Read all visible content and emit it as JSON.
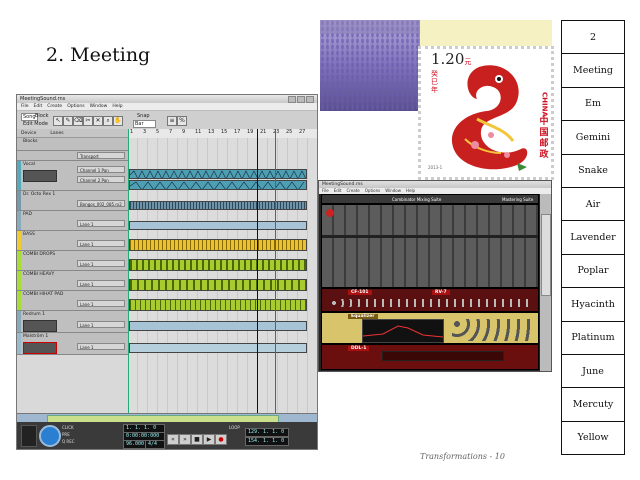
{
  "slide": {
    "title": "2. Meeting",
    "footer": "Transformations - 10"
  },
  "side_table": [
    "2",
    "Meeting",
    "Em",
    "Gemini",
    "Snake",
    "Air",
    "Lavender",
    "Poplar",
    "Hyacinth",
    "Platinum",
    "June",
    "Mercuty",
    "Yellow"
  ],
  "sequencer": {
    "window_title": "MeetingSound.rns",
    "menu": [
      "File",
      "Edit",
      "Create",
      "Options",
      "Window",
      "Help"
    ],
    "mode_tabs": [
      "Song",
      "Block"
    ],
    "edit_mode": "Edit Mode",
    "snap_label": "Snap",
    "snap_value": "Bar",
    "col_device": "Device",
    "col_lanes": "Lanes",
    "ruler_marks": [
      "1",
      "3",
      "5",
      "7",
      "9",
      "11",
      "13",
      "15",
      "17",
      "19",
      "21",
      "23",
      "25",
      "27"
    ],
    "tracks": [
      {
        "name": "Blocks",
        "lane": "",
        "color": "#cfcfcf",
        "clip": "none"
      },
      {
        "name": "Transport",
        "lane": "Transport",
        "color": "#cfcfcf",
        "clip": "none"
      },
      {
        "name": "Vocal",
        "lane": "Channel 1 Pan",
        "lane2": "Channel 2 Pan",
        "color": "#5ab",
        "clip": "wave"
      },
      {
        "name": "Dr. Octo Rex 1",
        "lane": "Bongos_002_085.rx2",
        "color": "#79a",
        "clip": "lines"
      },
      {
        "name": "PAD",
        "lane": "Lane 1",
        "color": "#8ab",
        "clip": "plain"
      },
      {
        "name": "BASS",
        "lane": "Lane 1",
        "color": "#ec3",
        "clip": "notes"
      },
      {
        "name": "COMBI DROPS",
        "lane": "Lane 1",
        "color": "#ad3",
        "clip": "dots"
      },
      {
        "name": "COMBI HEAVY",
        "lane": "Lane 1",
        "color": "#ad3",
        "clip": "dots"
      },
      {
        "name": "COMBI HIHAT PAD",
        "lane": "Lane 1",
        "color": "#ad3",
        "clip": "dots"
      },
      {
        "name": "Redrum 1",
        "lane": "Lane 1",
        "color": "#8ab",
        "clip": "plain"
      },
      {
        "name": "Malström 1",
        "lane": "Lane 1",
        "color": "#9bc",
        "clip": "plain"
      }
    ],
    "transport": {
      "position": "1. 1. 1. 0",
      "time": "0:00:00:000",
      "tempo": "96.000",
      "signature": "4/4",
      "left_loc": "129. 1. 1. 0",
      "right_loc": "154. 1. 1. 0",
      "click_label": "CLICK",
      "pre_label": "PRE",
      "quant_label": "Q REC",
      "loop_label": "LOOP"
    }
  },
  "stamp": {
    "price": "1.20",
    "price_unit": "元",
    "country_latin": "CHINA",
    "country_chinese": "中国邮政",
    "year_text": "癸巳年",
    "stamp_code": "2013-1"
  },
  "rack": {
    "window_title": "MeetingSound.rns",
    "menu": [
      "File",
      "Edit",
      "Create",
      "Options",
      "Window",
      "Help"
    ],
    "mixer_label": "Combinator Mixing Suite",
    "units": [
      {
        "label": "CF-101",
        "color": "#5a1010"
      },
      {
        "label": "RV-7",
        "color": "#7a1a1a"
      },
      {
        "label": "Equalizer",
        "color": "#d8c46a"
      },
      {
        "label": "DDL-1",
        "color": "#6a0e0e"
      }
    ],
    "mastering_label": "Mastering Suite"
  },
  "colors": {
    "lavender": "#8a7fc4",
    "stamp_red": "#c8201e",
    "stamp_bg": "#f6f1c3",
    "bass_yellow": "#e8c230",
    "combi_green": "#a8cc30"
  }
}
